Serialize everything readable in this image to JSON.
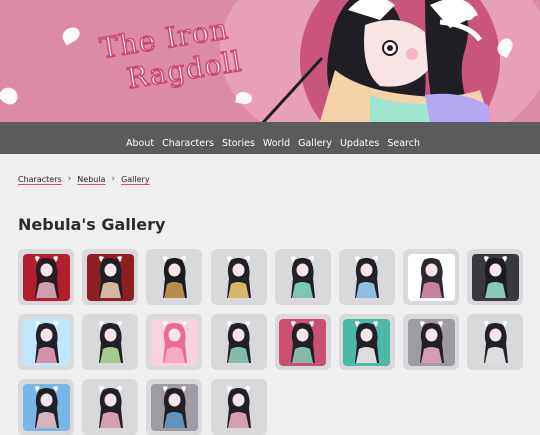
{
  "site": {
    "title_line1": "The Iron",
    "title_line2": "Ragdoll"
  },
  "nav": {
    "items": [
      "About",
      "Characters",
      "Stories",
      "World",
      "Gallery",
      "Updates",
      "Search"
    ]
  },
  "breadcrumb": {
    "items": [
      "Characters",
      "Nebula",
      "Gallery"
    ],
    "separator": "›"
  },
  "page": {
    "title": "Nebula's Gallery"
  },
  "gallery": {
    "thumbnails": [
      {
        "bg": "#b21e2e",
        "fig": "#2a1c20",
        "accent": "#e8b7c4"
      },
      {
        "bg": "#8b1f23",
        "fig": "#1f1e24",
        "accent": "#f1d3b6"
      },
      {
        "bg": "#d9d8da",
        "fig": "#1c1b1f",
        "accent": "#cfa15a"
      },
      {
        "bg": "#d9d8da",
        "fig": "#222027",
        "accent": "#f4d27a"
      },
      {
        "bg": "#d9d8da",
        "fig": "#222027",
        "accent": "#8fe3c8"
      },
      {
        "bg": "#d9d8da",
        "fig": "#222027",
        "accent": "#a8d8ff"
      },
      {
        "bg": "#ffffff",
        "fig": "#2a2830",
        "accent": "#e38fb0"
      },
      {
        "bg": "#3a3940",
        "fig": "#1c1b1f",
        "accent": "#9ee6d0"
      },
      {
        "bg": "#bfe8ff",
        "fig": "#222027",
        "accent": "#f2a6c4"
      },
      {
        "bg": "#d9d8da",
        "fig": "#222027",
        "accent": "#bfe6a8"
      },
      {
        "bg": "#f6d3df",
        "fig": "#e86a95",
        "accent": "#f7b6cb"
      },
      {
        "bg": "#d9d8da",
        "fig": "#222027",
        "accent": "#9ad6c2"
      },
      {
        "bg": "#c94f73",
        "fig": "#222027",
        "accent": "#9ad6c2"
      },
      {
        "bg": "#4bb9a6",
        "fig": "#222027",
        "accent": "#ffffff"
      },
      {
        "bg": "#9e9ba3",
        "fig": "#222027",
        "accent": "#f2b6c9"
      },
      {
        "bg": "#d9d8da",
        "fig": "#222027",
        "accent": "#ffffff"
      },
      {
        "bg": "#77b6e8",
        "fig": "#222027",
        "accent": "#f4cfdc"
      },
      {
        "bg": "#d9d8da",
        "fig": "#222027",
        "accent": "#f2b6c9"
      },
      {
        "bg": "#9e9ba3",
        "fig": "#222027",
        "accent": "#6fa8d8"
      },
      {
        "bg": "#d9d8da",
        "fig": "#222027",
        "accent": "#f2b6c9"
      }
    ]
  },
  "colors": {
    "banner": "#dd8aa6",
    "nav": "#5b5a5c",
    "accent": "#d24b6b",
    "page_bg": "#f0eff0"
  }
}
